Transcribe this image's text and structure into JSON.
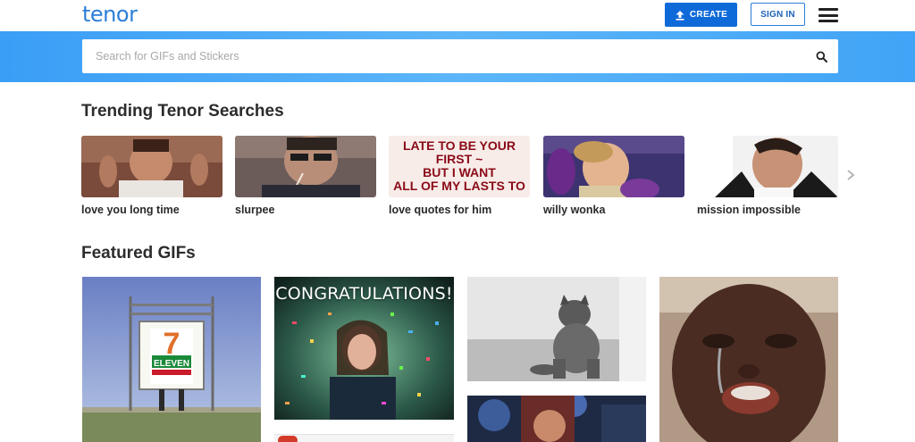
{
  "header": {
    "logo": "tenor",
    "create_label": "CREATE",
    "signin_label": "SIGN IN"
  },
  "search": {
    "placeholder": "Search for GIFs and Stickers"
  },
  "trending": {
    "title": "Trending Tenor Searches",
    "items": [
      {
        "label": "love you long time"
      },
      {
        "label": "slurpee"
      },
      {
        "label": "love quotes for him",
        "image_text": [
          "LATE TO BE YOUR",
          "FIRST ~",
          "BUT I WANT",
          "ALL OF MY LASTS TO"
        ]
      },
      {
        "label": "willy wonka"
      },
      {
        "label": "mission impossible"
      }
    ]
  },
  "featured": {
    "title": "Featured GIFs",
    "gifs": [
      {
        "name": "7-eleven sign",
        "sign_text": "ELEVEN"
      },
      {
        "name": "congratulations",
        "caption": "CONGRATULATIONS!"
      },
      {
        "name": "cat sitting"
      },
      {
        "name": "crying man"
      },
      {
        "name": "party"
      },
      {
        "name": "partial"
      }
    ]
  },
  "colors": {
    "brand_blue": "#2b7ed8",
    "create_bg": "#0f6ad9",
    "band_blue": "#3a9ef6"
  }
}
